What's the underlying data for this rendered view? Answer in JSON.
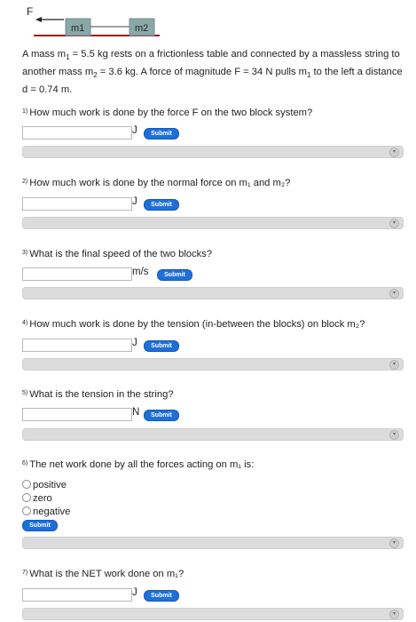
{
  "diagram": {
    "force_label": "F",
    "block1_label": "m1",
    "block2_label": "m2"
  },
  "problem": {
    "text_part1": "A mass m",
    "text_part2": "1",
    "text_part3": " = 5.5 kg rests on a frictionless table and connected by a massless string to another mass m",
    "text_part4": "2",
    "text_part5": " = 3.6 kg. A force of magnitude F = 34 N pulls m",
    "text_part6": "1",
    "text_part7": " to the left a distance d = 0.74 m."
  },
  "questions": [
    {
      "num": "1)",
      "text": "How much work is done by the force F on the two block system?",
      "unit": "J",
      "submit": "Submit"
    },
    {
      "num": "2)",
      "text": "How much work is done by the normal force on m₁ and m₂?",
      "unit": "J",
      "submit": "Submit"
    },
    {
      "num": "3)",
      "text": "What is the final speed of the two blocks?",
      "unit": "m/s",
      "submit": "Submit"
    },
    {
      "num": "4)",
      "text": "How much work is done by the tension (in-between the blocks) on block m₂?",
      "unit": "J",
      "submit": "Submit"
    },
    {
      "num": "5)",
      "text": "What is the tension in the string?",
      "unit": "N",
      "submit": "Submit"
    },
    {
      "num": "6)",
      "text": "The net work done by all the forces acting on m₁ is:",
      "options": [
        "positive",
        "zero",
        "negative"
      ],
      "submit": "Submit"
    },
    {
      "num": "7)",
      "text": "What is the NET work done on m₁?",
      "unit": "J",
      "submit": "Submit"
    }
  ],
  "colors": {
    "submit_blue": "#1e6fd9",
    "block_fill": "#8aa8a8",
    "hint_bar": "#dcdcdc"
  }
}
